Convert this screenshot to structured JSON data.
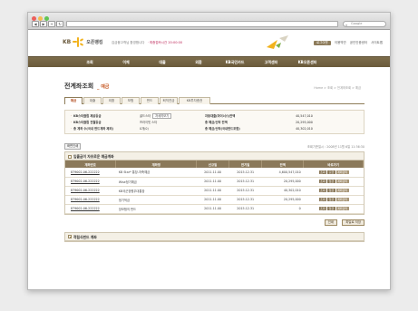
{
  "browser": {
    "nav_buttons": [
      "◀",
      "▶",
      "+",
      "↻"
    ],
    "search_placeholder": "Google"
  },
  "header": {
    "kb": "KB",
    "bank_name": "오픈뱅킹",
    "greeting": "김금융고객님 환영합니다",
    "time": "· 최종접속시간 20:00:00",
    "login_label": "로그아웃",
    "top_links": [
      "이용약관",
      "공인인증센터",
      "사이트맵"
    ]
  },
  "menu": [
    "조회",
    "이체",
    "대출",
    "외환",
    "KB국민카드",
    "고객센터",
    "KB오픈센터"
  ],
  "page": {
    "title": "전계좌조회",
    "subtitle": "예금",
    "breadcrumb": "Home > 조회 > 전계좌조회 > 예금"
  },
  "tabs": [
    "예금",
    "대출",
    "외환",
    "보험",
    "펀드",
    "퇴직연금",
    "KB투자증권"
  ],
  "summary": {
    "rows": [
      {
        "label1": "KB스타클럽 제공등급",
        "value1": "골드스타",
        "chip": "자세히보기",
        "label2": "자동대출(마이너스)잔액",
        "value2": "40,547,010"
      },
      {
        "label1": "KB스타클럽 전월등급",
        "value1": "프라이빗 스타",
        "chip": "",
        "label2": "총 예금/신탁 잔액",
        "value2": "20,295,000"
      },
      {
        "label1": "총 계좌 수(국내 펀드계좌 제외)",
        "value1": "0개(0)",
        "chip": "",
        "label2": "총 예금/신탁(국내펀드포함)",
        "value2": "40,302,010"
      }
    ]
  },
  "toolbar": {
    "print_label": "화면인쇄",
    "lookup_date": "조회기준일시 : 2008년 11월 6일 11:36:30"
  },
  "section1": {
    "title": "입출금이 자유로운 예금계좌",
    "columns": [
      "계좌번호",
      "계좌명",
      "신규일",
      "만기일",
      "잔액",
      "바로가기"
    ],
    "rows": [
      {
        "account": "879002-06-222222",
        "name": "KB Star* 통장-저축예금",
        "opened": "2011.11.00",
        "maturity": "2015.12.31",
        "balance": "4,600,547,010",
        "actions": [
          "조회",
          "출금",
          "계좌관리"
        ]
      },
      {
        "account": "879002-06-222222",
        "name": "Wise정기예금",
        "opened": "2011.11.00",
        "maturity": "2015.12.31",
        "balance": "20,295,000",
        "actions": [
          "조회",
          "입금",
          "계좌관리"
        ]
      },
      {
        "account": "879002-06-222222",
        "name": "KB국군장병우대통장",
        "opened": "2011.11.00",
        "maturity": "2015.12.31",
        "balance": "40,302,010",
        "actions": [
          "조회",
          "입금",
          "계좌관리"
        ]
      },
      {
        "account": "879002-06-222222",
        "name": "정기적금",
        "opened": "2011.11.00",
        "maturity": "2015.12.31",
        "balance": "20,295,000",
        "actions": [
          "조회",
          "입금",
          "계좌관리"
        ]
      },
      {
        "account": "879002-06-222222",
        "name": "장보험의 펀드",
        "opened": "2011.11.00",
        "maturity": "2015.12.31",
        "balance": "0",
        "actions": [
          "조회",
          "입금",
          "계좌관리"
        ]
      }
    ]
  },
  "bottom_buttons": [
    "인쇄",
    "파일로 저장"
  ],
  "section2": {
    "title": "적립식펀드 계좌"
  }
}
